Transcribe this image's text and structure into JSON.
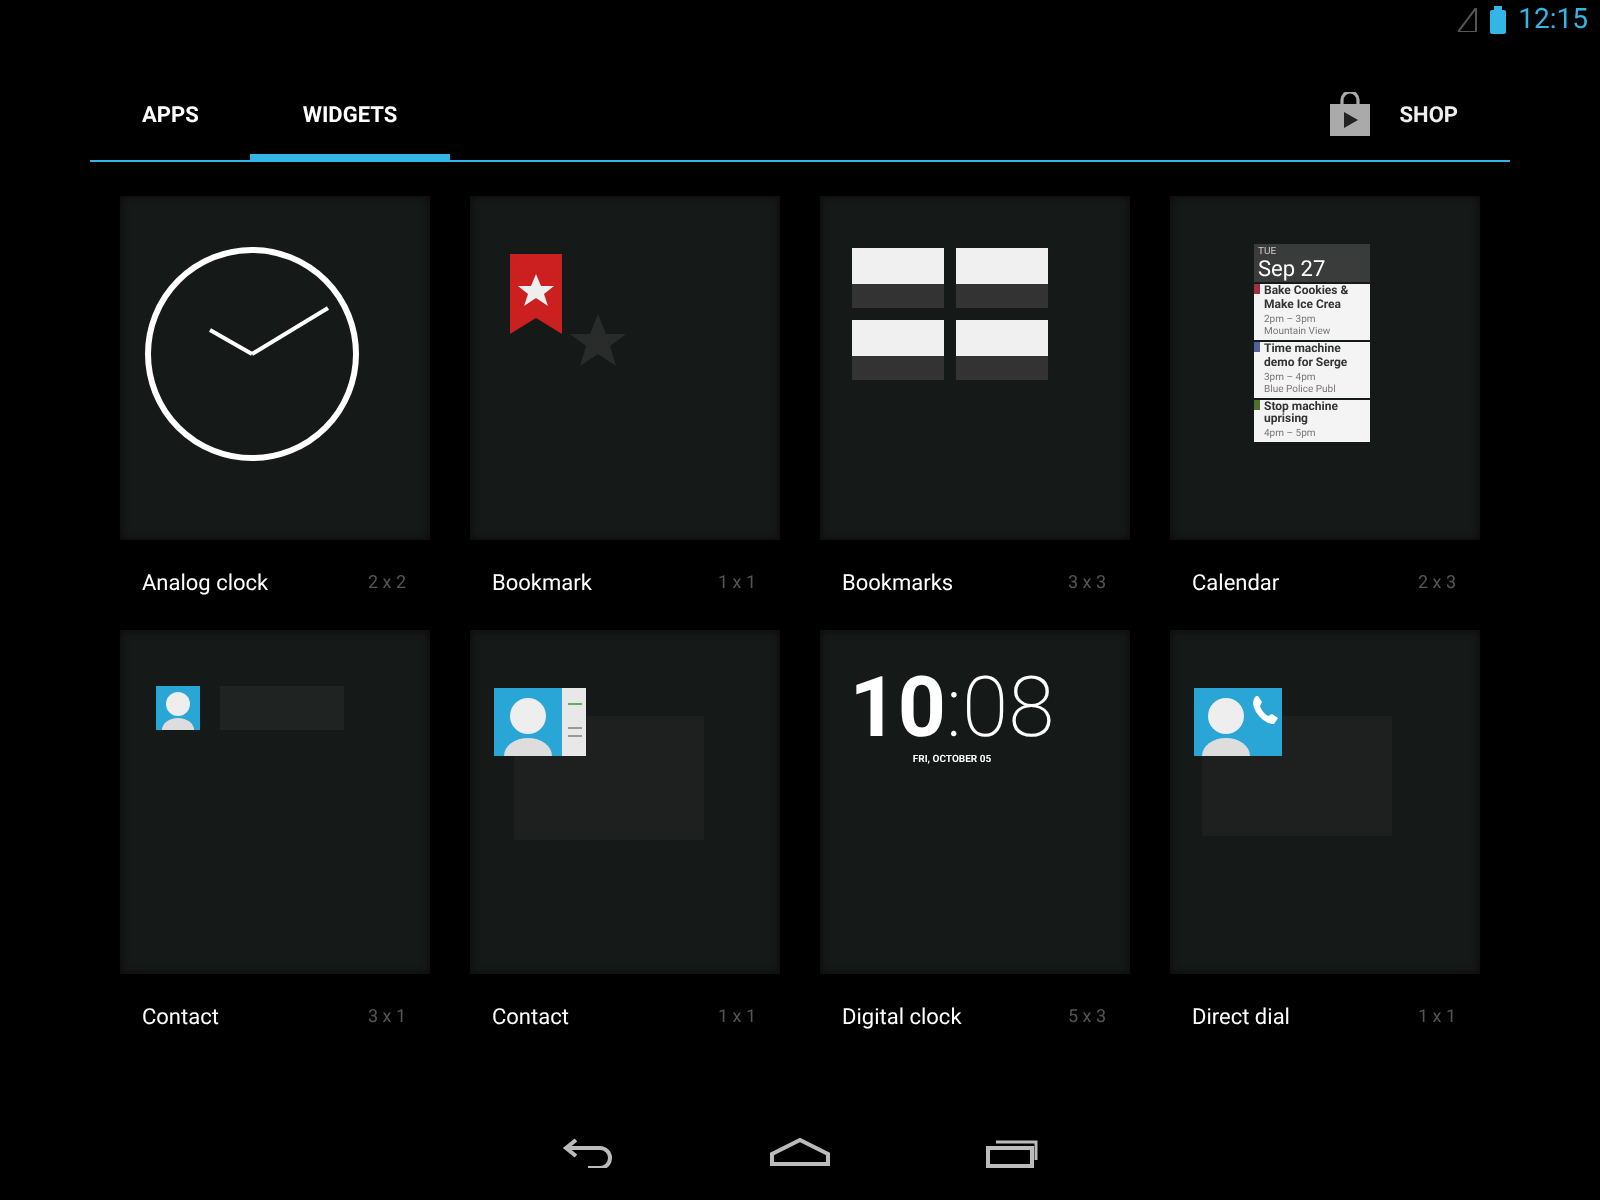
{
  "status_bar": {
    "time": "12:15"
  },
  "tabs": [
    {
      "label": "APPS",
      "selected": false
    },
    {
      "label": "WIDGETS",
      "selected": true
    }
  ],
  "shop": {
    "label": "SHOP"
  },
  "widgets": [
    {
      "name": "Analog clock",
      "size": "2 x 2",
      "preview": {
        "kind": "analog_clock"
      }
    },
    {
      "name": "Bookmark",
      "size": "1 x 1",
      "preview": {
        "kind": "bookmark"
      }
    },
    {
      "name": "Bookmarks",
      "size": "3 x 3",
      "preview": {
        "kind": "bookmarks"
      }
    },
    {
      "name": "Calendar",
      "size": "2 x 3",
      "preview": {
        "kind": "calendar",
        "weekday": "TUE",
        "date": "Sep 27",
        "events": [
          {
            "title": "Bake Cookies & Make Ice Crea",
            "time": "2pm – 3pm",
            "place": "Mountain View",
            "color": "#a03040"
          },
          {
            "title": "Time machine demo for Serge",
            "time": "3pm – 4pm",
            "place": "Blue Police Publ",
            "color": "#5060a0"
          },
          {
            "title": "Stop machine uprising",
            "time": "4pm – 5pm",
            "color": "#507030"
          }
        ]
      }
    },
    {
      "name": "Contact",
      "size": "3 x 1",
      "preview": {
        "kind": "contact_row"
      }
    },
    {
      "name": "Contact",
      "size": "1 x 1",
      "preview": {
        "kind": "contact_card"
      }
    },
    {
      "name": "Digital clock",
      "size": "5 x 3",
      "preview": {
        "kind": "digital_clock",
        "hours": "10",
        "minutes": ":08",
        "date": "FRI, OCTOBER 05"
      }
    },
    {
      "name": "Direct dial",
      "size": "1 x 1",
      "preview": {
        "kind": "direct_dial"
      }
    }
  ]
}
